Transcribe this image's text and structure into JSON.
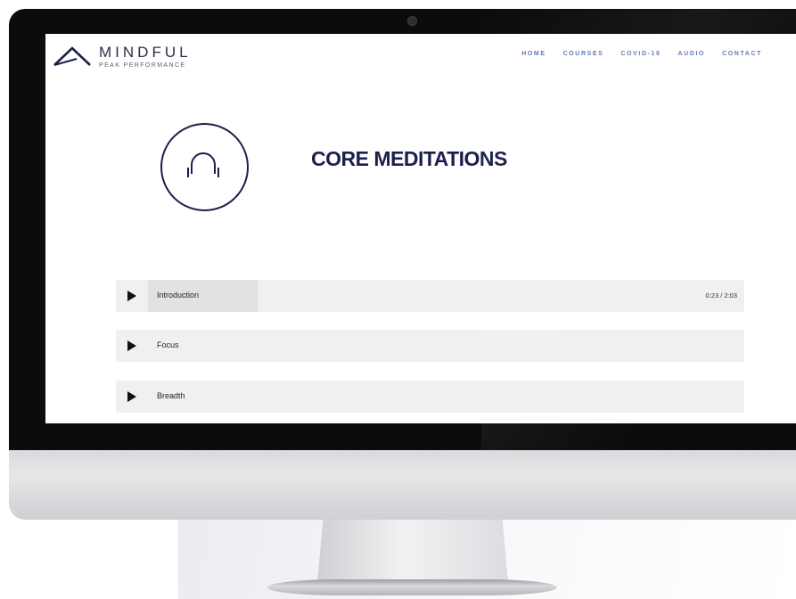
{
  "brand": {
    "name": "MINDFUL",
    "tagline": "PEAK PERFORMANCE"
  },
  "nav": {
    "items": [
      "HOME",
      "COURSES",
      "COVID-19",
      "AUDIO",
      "CONTACT"
    ]
  },
  "page": {
    "icon": "headphones-icon",
    "title": "CORE MEDITATIONS"
  },
  "tracks": [
    {
      "title": "Introduction",
      "time": "0:23 / 2:03",
      "progress": 0.184,
      "icon": "play-icon"
    },
    {
      "title": "Focus",
      "icon": "play-icon"
    },
    {
      "title": "Breadth",
      "icon": "play-icon"
    }
  ],
  "colors": {
    "brand_navy": "#1b1f4c",
    "nav_blue": "#5b78b8",
    "track_bg": "#f0f0f0"
  }
}
